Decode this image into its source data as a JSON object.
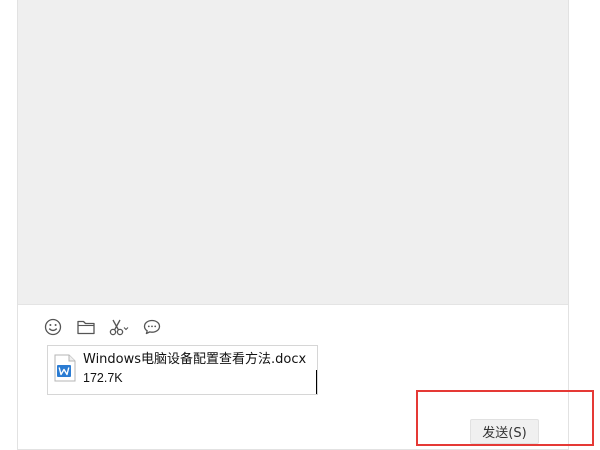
{
  "toolbar": {
    "items": [
      {
        "icon": "emoji-icon"
      },
      {
        "icon": "folder-icon"
      },
      {
        "icon": "scissors-icon"
      },
      {
        "icon": "chat-bubble-icon"
      }
    ]
  },
  "attachment": {
    "name": "Windows电脑设备配置查看方法.docx",
    "size": "172.7K",
    "icon": "word-doc-icon",
    "icon_color": "#2b7cd3"
  },
  "send_button": {
    "label": "发送(S)"
  },
  "colors": {
    "history_bg": "#efefef",
    "highlight": "#e53935"
  }
}
